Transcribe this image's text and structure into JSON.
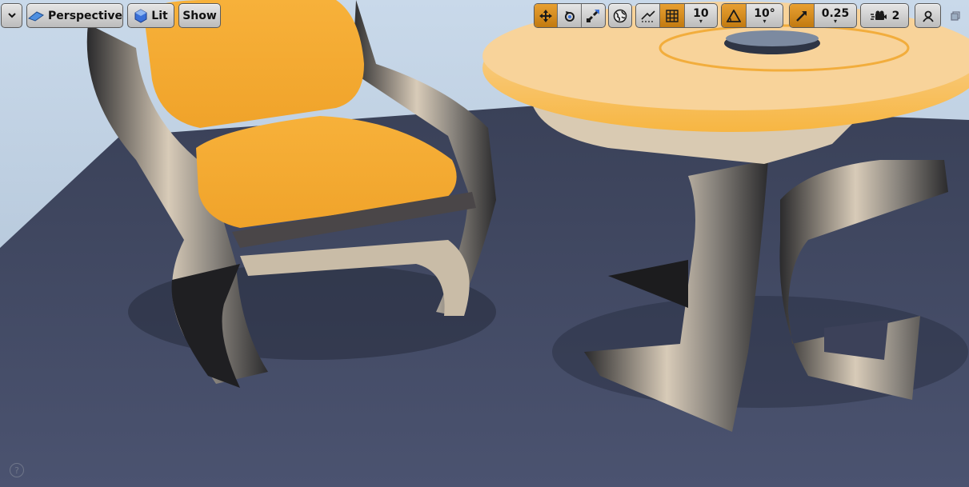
{
  "toolbar": {
    "menu_icon": "chevron-down-icon",
    "perspective_label": "Perspective",
    "lit_label": "Lit",
    "show_label": "Show",
    "grid_snap_value": "10",
    "rotation_snap_value": "10°",
    "scale_snap_value": "0.25",
    "camera_speed_value": "2",
    "accent_color": "#d98f1f"
  },
  "help": {
    "icon_text": "?"
  }
}
